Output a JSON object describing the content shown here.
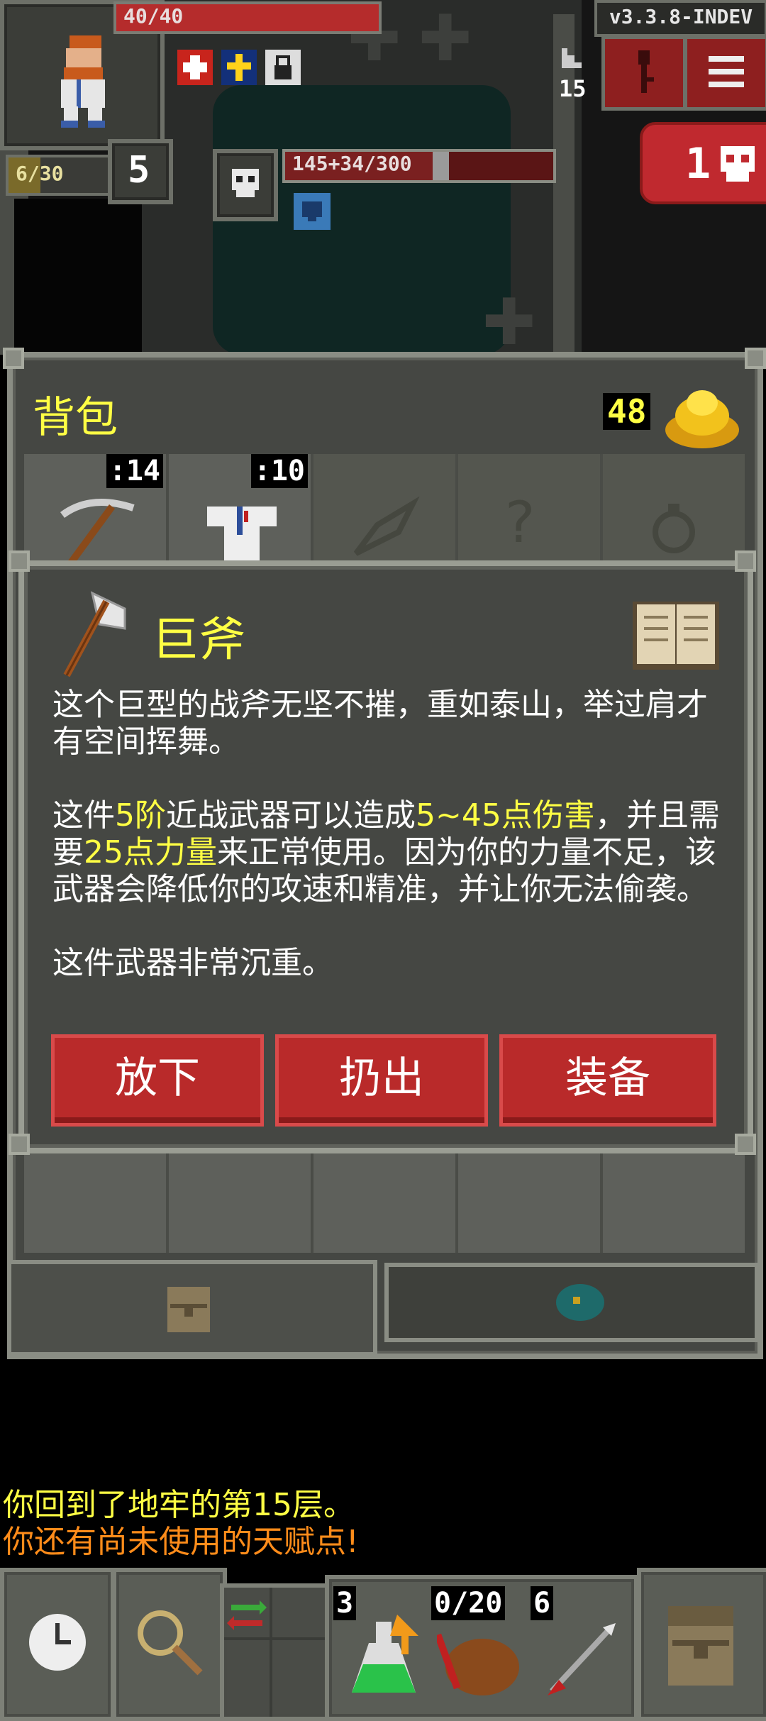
{
  "hud": {
    "hp": "40/40",
    "version": "v3.3.8-INDEV",
    "exp": "6/30",
    "level": "5",
    "depth": "15",
    "boss_hp": "145+34/300",
    "danger_count": "1"
  },
  "backpack": {
    "title": "背包",
    "gold": "48",
    "slot_quantities": [
      ":14",
      ":10"
    ]
  },
  "item": {
    "name": "巨斧",
    "desc_1": "这个巨型的战斧无坚不摧，重如泰山，举过肩才有空间挥舞。",
    "p2_a": "这件",
    "p2_tier": "5阶",
    "p2_b": "近战武器可以造成",
    "p2_dmg": "5~45点伤害",
    "p2_c": "，并且需要",
    "p2_str": "25点力量",
    "p2_d": "来正常使用。因为你的力量不足，该武器会降低你的攻速和精准，并让你无法偷袭。",
    "desc_3": "这件武器非常沉重。",
    "buttons": {
      "drop": "放下",
      "throw": "扔出",
      "equip": "装备"
    }
  },
  "log": {
    "line1": "你回到了地牢的第15层。",
    "line2": "你还有尚未使用的天赋点!"
  },
  "toolbar": {
    "quickslot_1_qty": "3",
    "quickslot_2_qty": "0/20",
    "quickslot_3_qty": "6"
  },
  "colors": {
    "highlight": "#ffff44",
    "log_warning": "#ff8c1a",
    "button_red": "#b92a2a"
  }
}
